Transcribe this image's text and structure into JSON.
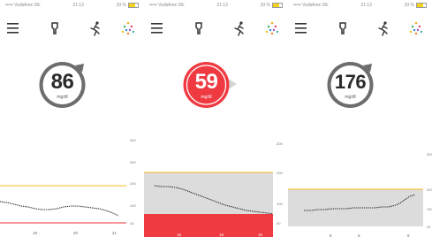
{
  "colors": {
    "normal_ring": "#6d6d6d",
    "alert_fill": "#ef3a42",
    "upper_limit_line": "#f4b81e",
    "lower_limit_line": "#ee2f36",
    "target_band": "#dcdcdc",
    "low_zone": "#ef3a42",
    "curve": "#1f1f1f"
  },
  "screens": [
    {
      "status": {
        "carrier": "Vodafone DE",
        "time": "21:12",
        "battery": "33 %"
      },
      "nav": [
        {
          "icon": "menu-icon"
        },
        {
          "icon": "sensor-icon"
        },
        {
          "icon": "activity-runner-icon"
        },
        {
          "icon": "color-dots-icon"
        }
      ],
      "reading": {
        "value": "86",
        "unit": "mg/dl",
        "style": "normal",
        "indicator_visible": true
      },
      "chart": {
        "type": "line",
        "y_tick_labels": [
          "400",
          "300",
          "200",
          "100",
          "40"
        ],
        "x_tick_labels": [
          "18",
          "20",
          "21"
        ],
        "band": {
          "high": 180,
          "low": 70
        },
        "low_zone_visible": false
      }
    },
    {
      "status": {
        "carrier": "Vodafone DE",
        "time": "21:12",
        "battery": "33 %"
      },
      "nav": [
        {
          "icon": "menu-icon"
        },
        {
          "icon": "sensor-icon"
        },
        {
          "icon": "activity-runner-icon"
        },
        {
          "icon": "color-dots-icon"
        }
      ],
      "reading": {
        "value": "59",
        "unit": "mg/dl",
        "style": "alert",
        "indicator_visible": true
      },
      "chart": {
        "type": "line",
        "y_tick_labels": [
          "300",
          "200",
          "100",
          "40"
        ],
        "x_tick_labels": [
          "18",
          "18",
          "19"
        ],
        "band": {
          "high": 200,
          "low": 60
        },
        "low_zone_visible": true
      }
    },
    {
      "status": {
        "carrier": "Vodafone DE",
        "time": "21:12",
        "battery": "33 %"
      },
      "nav": [
        {
          "icon": "menu-icon"
        },
        {
          "icon": "sensor-icon"
        },
        {
          "icon": "activity-runner-icon"
        },
        {
          "icon": "color-dots-icon"
        }
      ],
      "reading": {
        "value": "176",
        "unit": "mg/dl",
        "style": "normal",
        "indicator_visible": true
      },
      "chart": {
        "type": "line",
        "y_tick_labels": [
          "300",
          "200",
          "100",
          "40"
        ],
        "x_tick_labels": [
          "8",
          "8",
          "8"
        ],
        "band": {
          "high": 200,
          "low": 70
        },
        "low_zone_visible": false
      }
    }
  ]
}
